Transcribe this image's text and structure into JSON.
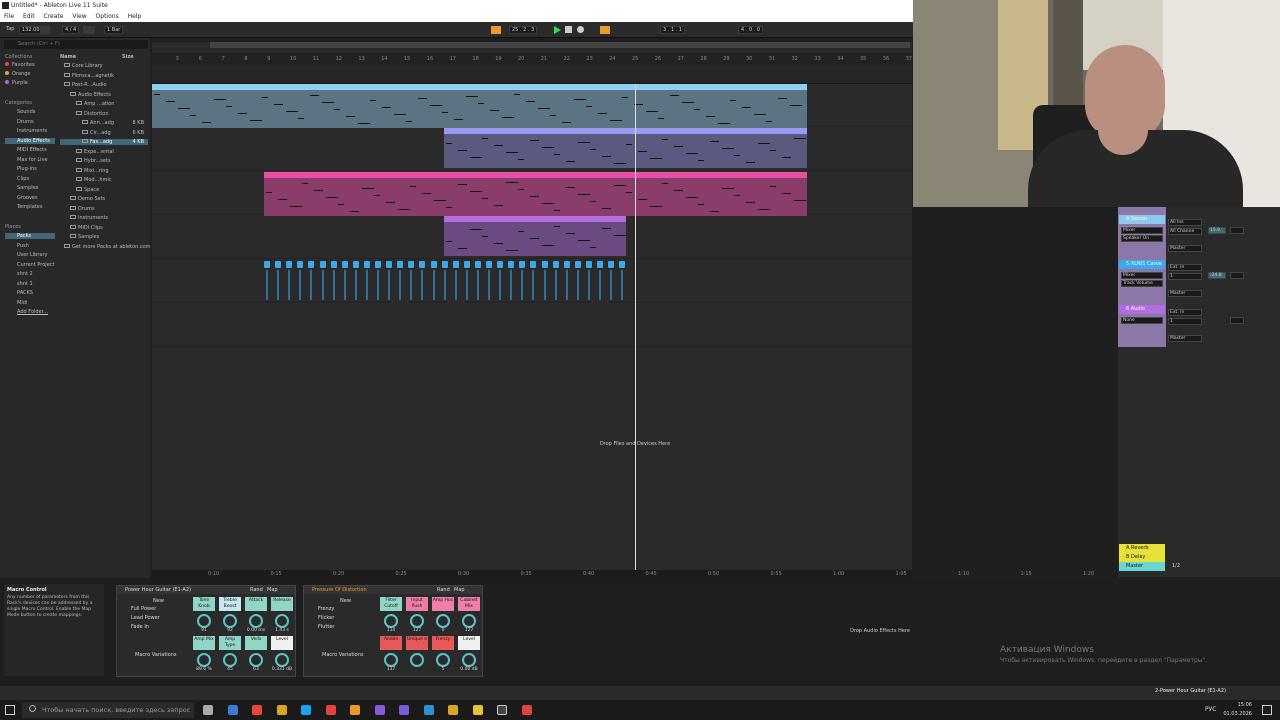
{
  "window": {
    "title": "Untitled* - Ableton Live 11 Suite"
  },
  "menu": [
    "File",
    "Edit",
    "Create",
    "View",
    "Options",
    "Help"
  ],
  "control": {
    "tap": "Tap",
    "tempo": "132.00",
    "time_sig": "4 / 4",
    "quant": "1 Bar",
    "position": "25 .  2 .  3",
    "loop_start": "3 .  1 .  1",
    "loop_len": "4 .  0 .  0"
  },
  "browser": {
    "search_placeholder": "Search (Ctrl + F)",
    "col_name": "Name",
    "col_size": "Size",
    "collections_head": "Collections",
    "collections": [
      {
        "label": "Favorites",
        "color": "#e8463a"
      },
      {
        "label": "Orange",
        "color": "#f59a2b"
      },
      {
        "label": "Purple",
        "color": "#a36be0"
      }
    ],
    "categories_head": "Categories",
    "categories": [
      "Sounds",
      "Drums",
      "Instruments",
      "Audio Effects",
      "MIDI Effects",
      "Max for Live",
      "Plug-ins",
      "Clips",
      "Samples",
      "Grooves",
      "Templates"
    ],
    "places_head": "Places",
    "places": [
      "Packs",
      "Push",
      "User Library",
      "Current Project",
      "shnt 2",
      "shnt 1",
      "PACKS",
      "Midi",
      "Add Folder..."
    ],
    "tree": [
      {
        "label": "Core Library",
        "indent": 0
      },
      {
        "label": "Filmsca...agnetik",
        "indent": 0
      },
      {
        "label": "Post-R...Audio",
        "indent": 0
      },
      {
        "label": "Audio Effects",
        "indent": 1
      },
      {
        "label": "Amp ...ation",
        "indent": 2
      },
      {
        "label": "Distortion",
        "indent": 2
      },
      {
        "label": "Ann...adg",
        "indent": 3,
        "size": "8 KB"
      },
      {
        "label": "Cir...adg",
        "indent": 3,
        "size": "6 KB"
      },
      {
        "label": "Fas...adg",
        "indent": 3,
        "size": "4 KB"
      },
      {
        "label": "Expe...ental",
        "indent": 2
      },
      {
        "label": "Hybr...sets",
        "indent": 2
      },
      {
        "label": "Mixi...ring",
        "indent": 2
      },
      {
        "label": "Mod...hmic",
        "indent": 2
      },
      {
        "label": "Space",
        "indent": 2
      },
      {
        "label": "Demo Sets",
        "indent": 1
      },
      {
        "label": "Drums",
        "indent": 1
      },
      {
        "label": "Instruments",
        "indent": 1
      },
      {
        "label": "MIDI Clips",
        "indent": 1
      },
      {
        "label": "Samples",
        "indent": 1
      },
      {
        "label": "Get more Packs at ableton.com",
        "indent": 0
      }
    ]
  },
  "ruler": [
    "5",
    "6",
    "7",
    "8",
    "9",
    "10",
    "11",
    "12",
    "13",
    "14",
    "15",
    "16",
    "17",
    "18",
    "19",
    "20",
    "21",
    "22",
    "23",
    "24",
    "25",
    "26",
    "27",
    "28",
    "29",
    "30",
    "31",
    "32",
    "33",
    "34",
    "35",
    "36",
    "37"
  ],
  "time_ruler": [
    "0:10",
    "0:15",
    "0:20",
    "0:25",
    "0:30",
    "0:35",
    "0:40",
    "0:45",
    "0:50",
    "0:55",
    "1:00",
    "1:05",
    "1:10",
    "1:15",
    "1:20"
  ],
  "arrangement": {
    "drop_text": "Drop Files and Devices Here"
  },
  "tracks": [
    {
      "name": "4 Serum",
      "color": "#8fc8ef",
      "c1": "All Ins",
      "c2": "Mixer",
      "c3": "Speaker On",
      "c4": "All Channe",
      "c5": "Master",
      "vol": "15.9"
    },
    {
      "name": "5 XLN/1 Carve",
      "color": "#3da9e8",
      "c1": "Ext. In",
      "c2": "Mixer",
      "c3": "Track Volume",
      "c4": "1",
      "c5": "Master",
      "vol": "-24.8"
    },
    {
      "name": "6 Audio",
      "color": "#b36de0",
      "c1": "Ext. In",
      "c2": "None",
      "c3": "",
      "c4": "1",
      "c5": "Master",
      "vol": ""
    }
  ],
  "returns": [
    {
      "name": "A Reverb",
      "color": "#e8e13a"
    },
    {
      "name": "B Delay",
      "color": "#e8e13a"
    },
    {
      "name": "Master",
      "color": "#6ad6d0"
    }
  ],
  "master_ratio": "1/2",
  "info_view": {
    "title": "Macro Control",
    "text": "Any number of parameters from this Rack's devices can be addressed by a single Macro Control. Enable the Map Mode button to create mappings."
  },
  "rack1": {
    "title": "Power Hour Guitar (E1-A2)",
    "rand": "Rand",
    "map": "Map",
    "new": "New",
    "chains": [
      "Full Power",
      "Lead Power",
      "Fade In"
    ],
    "macros_row1": [
      {
        "label": "Tone Knob",
        "value": "91",
        "color": "#8fd6c7"
      },
      {
        "label": "Treble Boost",
        "value": "92",
        "color": "#c6e6f2"
      },
      {
        "label": "Attack",
        "value": "0.00 ms",
        "color": "#8fd6c7"
      },
      {
        "label": "Release",
        "value": "1.43 s",
        "color": "#8fd6c7"
      }
    ],
    "macros_row2": [
      {
        "label": "Amp Mix",
        "value": "89.6 %",
        "color": "#8fd6c7"
      },
      {
        "label": "Amp Type",
        "value": "45",
        "color": "#8fd6c7"
      },
      {
        "label": "Verb",
        "value": "63",
        "color": "#8fd6c7"
      },
      {
        "label": "Level",
        "value": "0.331 dB",
        "color": "#f0f0f0"
      }
    ],
    "variations": "Macro Variations"
  },
  "rack2": {
    "title": "Pressure Of Distortion",
    "rand": "Rand",
    "map": "Map",
    "new": "New",
    "chains": [
      "Frenzy",
      "Flicker",
      "Flutter"
    ],
    "macros_row1": [
      {
        "label": "Filter Cutoff",
        "value": "114",
        "color": "#8fd6c7"
      },
      {
        "label": "Input Push",
        "value": "127",
        "color": "#ef7fa9"
      },
      {
        "label": "Amp Hoc",
        "value": "0",
        "color": "#ef7fa9"
      },
      {
        "label": "Cabinet Mix",
        "value": "127",
        "color": "#ef7fa9"
      }
    ],
    "macros_row2": [
      {
        "label": "Amble",
        "value": "137",
        "color": "#e85a5a"
      },
      {
        "label": "Unique e",
        "value": "",
        "color": "#e85a5a"
      },
      {
        "label": "Frenzy",
        "value": "5",
        "color": "#e85a5a"
      },
      {
        "label": "Level",
        "value": "0.00 dB",
        "color": "#f0f0f0"
      }
    ],
    "variations": "Macro Variations"
  },
  "device_drop_text": "Drop Audio Effects Here",
  "activation": {
    "title": "Активация Windows",
    "subtitle": "Чтобы активировать Windows, перейдите в раздел \"Параметры\"."
  },
  "status": {
    "selected": "2-Power Hour Guitar (E1-A2)"
  },
  "taskbar": {
    "search_placeholder": "Чтобы начать поиск, введите здесь запрос",
    "lang": "РУС",
    "time": "15:06",
    "date": "01.03.2026"
  }
}
